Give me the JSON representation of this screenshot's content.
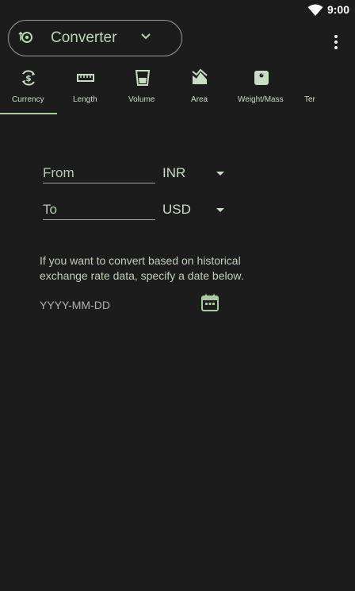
{
  "status_bar": {
    "time": "9:00",
    "wifi_icon": "wifi-icon"
  },
  "header": {
    "mode_icon": "converter-icon",
    "mode_title": "Converter",
    "chevron_icon": "chevron-down-icon",
    "overflow_icon": "more-vert-icon"
  },
  "tabs": [
    {
      "label": "Currency",
      "icon": "currency-exchange-icon",
      "selected": true
    },
    {
      "label": "Length",
      "icon": "ruler-icon",
      "selected": false
    },
    {
      "label": "Volume",
      "icon": "cup-icon",
      "selected": false
    },
    {
      "label": "Area",
      "icon": "area-icon",
      "selected": false
    },
    {
      "label": "Weight/Mass",
      "icon": "scale-icon",
      "selected": false
    },
    {
      "label": "Ter",
      "icon": "",
      "selected": false
    }
  ],
  "form": {
    "from_label": "From",
    "from_currency": "INR",
    "to_label": "To",
    "to_currency": "USD",
    "hint": "If you want to convert based on historical exchange rate data, specify a date below.",
    "date_placeholder": "YYYY-MM-DD",
    "calendar_icon": "calendar-icon"
  },
  "colors": {
    "background": "#1c1c1c",
    "accent": "#a8c8a0",
    "text": "#c9dcc4"
  }
}
